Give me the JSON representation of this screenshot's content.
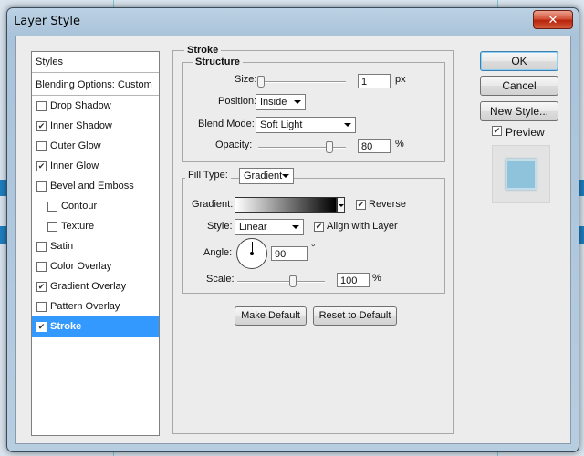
{
  "window": {
    "title": "Layer Style",
    "close_icon": "close-icon"
  },
  "styles_panel": {
    "header": "Styles",
    "blending_options": "Blending Options: Custom",
    "items": [
      {
        "label": "Drop Shadow",
        "checked": false,
        "sub": false,
        "selected": false
      },
      {
        "label": "Inner Shadow",
        "checked": true,
        "sub": false,
        "selected": false
      },
      {
        "label": "Outer Glow",
        "checked": false,
        "sub": false,
        "selected": false
      },
      {
        "label": "Inner Glow",
        "checked": true,
        "sub": false,
        "selected": false
      },
      {
        "label": "Bevel and Emboss",
        "checked": false,
        "sub": false,
        "selected": false
      },
      {
        "label": "Contour",
        "checked": false,
        "sub": true,
        "selected": false
      },
      {
        "label": "Texture",
        "checked": false,
        "sub": true,
        "selected": false
      },
      {
        "label": "Satin",
        "checked": false,
        "sub": false,
        "selected": false
      },
      {
        "label": "Color Overlay",
        "checked": false,
        "sub": false,
        "selected": false
      },
      {
        "label": "Gradient Overlay",
        "checked": true,
        "sub": false,
        "selected": false
      },
      {
        "label": "Pattern Overlay",
        "checked": false,
        "sub": false,
        "selected": false
      },
      {
        "label": "Stroke",
        "checked": true,
        "sub": false,
        "selected": true
      }
    ]
  },
  "stroke": {
    "section_title": "Stroke",
    "structure": {
      "title": "Structure",
      "size_label": "Size:",
      "size_value": "1",
      "size_unit": "px",
      "position_label": "Position:",
      "position_value": "Inside",
      "blend_mode_label": "Blend Mode:",
      "blend_mode_value": "Soft Light",
      "opacity_label": "Opacity:",
      "opacity_value": "80",
      "opacity_unit": "%"
    },
    "fill": {
      "fill_type_label": "Fill Type:",
      "fill_type_value": "Gradient",
      "gradient_label": "Gradient:",
      "reverse_label": "Reverse",
      "reverse_checked": true,
      "style_label": "Style:",
      "style_value": "Linear",
      "align_label": "Align with Layer",
      "align_checked": true,
      "angle_label": "Angle:",
      "angle_value": "90",
      "angle_unit": "°",
      "scale_label": "Scale:",
      "scale_value": "100",
      "scale_unit": "%"
    },
    "make_default": "Make Default",
    "reset_default": "Reset to Default"
  },
  "actions": {
    "ok": "OK",
    "cancel": "Cancel",
    "new_style": "New Style...",
    "preview_label": "Preview",
    "preview_checked": true
  },
  "colors": {
    "selection": "#3399ff",
    "background_band": "#1f7fc0",
    "close": "#c8391e"
  }
}
